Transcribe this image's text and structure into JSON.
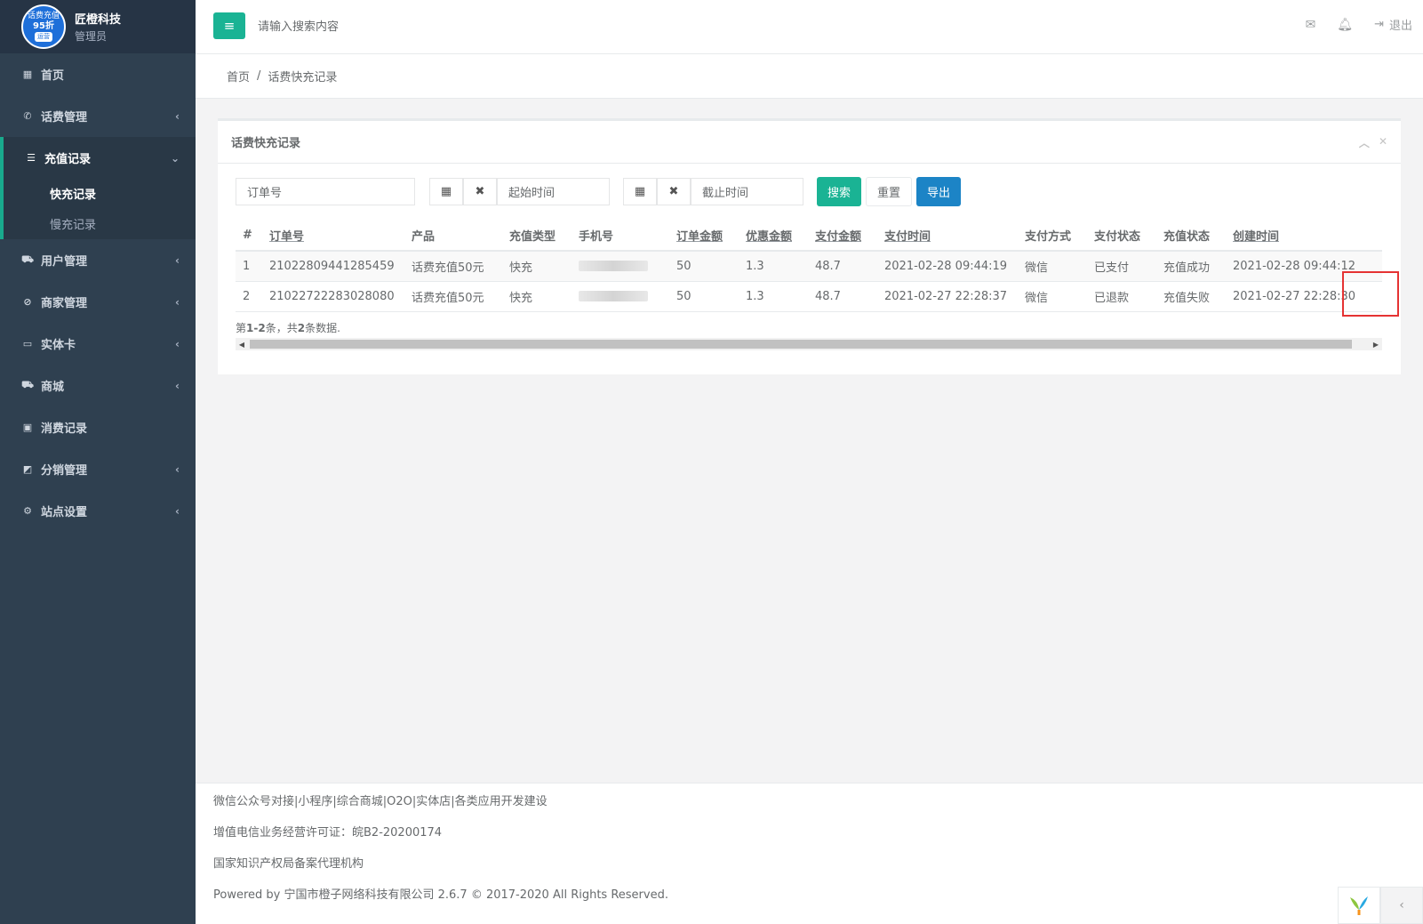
{
  "brand": {
    "logo_line1": "话费充值",
    "logo_line2": "95折",
    "logo_tag": "运营",
    "name": "匠橙科技",
    "role": "管理员"
  },
  "sidebar": {
    "items": [
      {
        "label": "首页",
        "icon": "dashboard-icon"
      },
      {
        "label": "话费管理",
        "icon": "phone-icon"
      },
      {
        "label": "充值记录",
        "icon": "list-icon"
      },
      {
        "label": "用户管理",
        "icon": "cart-icon"
      },
      {
        "label": "商家管理",
        "icon": "compass-icon"
      },
      {
        "label": "实体卡",
        "icon": "card-icon"
      },
      {
        "label": "商城",
        "icon": "cart-icon"
      },
      {
        "label": "消费记录",
        "icon": "money-icon"
      },
      {
        "label": "分销管理",
        "icon": "chart-icon"
      },
      {
        "label": "站点设置",
        "icon": "gear-icon"
      }
    ],
    "sub_items": [
      {
        "label": "快充记录",
        "active": true
      },
      {
        "label": "慢充记录",
        "active": false
      }
    ]
  },
  "topbar": {
    "search_placeholder": "请输入搜索内容",
    "logout": "退出"
  },
  "breadcrumb": {
    "home": "首页",
    "separator": "/",
    "current": "话费快充记录"
  },
  "panel": {
    "title": "话费快充记录",
    "filters": {
      "order_placeholder": "订单号",
      "start_placeholder": "起始时间",
      "end_placeholder": "截止时间",
      "search": "搜索",
      "reset": "重置",
      "export": "导出"
    },
    "table": {
      "headers": [
        "#",
        "订单号",
        "产品",
        "充值类型",
        "手机号",
        "订单金额",
        "优惠金额",
        "支付金额",
        "支付时间",
        "支付方式",
        "支付状态",
        "充值状态",
        "创建时间"
      ],
      "rows": [
        [
          "1",
          "21022809441285459",
          "话费充值50元",
          "快充",
          "",
          "50",
          "1.3",
          "48.7",
          "2021-02-28 09:44:19",
          "微信",
          "已支付",
          "充值成功",
          "2021-02-28 09:44:12"
        ],
        [
          "2",
          "21022722283028080",
          "话费充值50元",
          "快充",
          "",
          "50",
          "1.3",
          "48.7",
          "2021-02-27 22:28:37",
          "微信",
          "已退款",
          "充值失败",
          "2021-02-27 22:28:30"
        ]
      ]
    },
    "summary_prefix": "第",
    "summary_range": "1-2",
    "summary_mid": "条，共",
    "summary_total": "2",
    "summary_suffix": "条数据."
  },
  "footer": {
    "line1": "微信公众号对接|小程序|综合商城|O2O|实体店|各类应用开发建设",
    "line2": "增值电信业务经营许可证：皖B2-20200174",
    "line3": "国家知识产权局备案代理机构",
    "line4": "Powered by 宁国市橙子网络科技有限公司 2.6.7 © 2017-2020 All Rights Reserved."
  }
}
